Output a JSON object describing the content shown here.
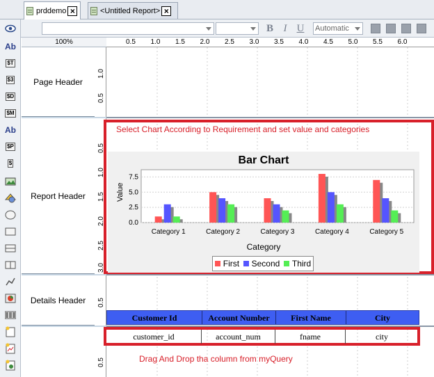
{
  "tabs": [
    {
      "label": "prddemo",
      "active": true
    },
    {
      "label": "<Untitled Report>",
      "active": false
    }
  ],
  "toolbar": {
    "font_size_value": "Automatic",
    "bold_label": "B",
    "italic_label": "I",
    "underline_label": "U"
  },
  "palette": [
    {
      "label": "Ab",
      "icon": "text-field-icon"
    },
    {
      "label": "$T",
      "icon": "string-field-icon"
    },
    {
      "label": "$3",
      "icon": "number-field-icon"
    },
    {
      "label": "$D",
      "icon": "date-field-icon"
    },
    {
      "label": "$M",
      "icon": "message-field-icon"
    },
    {
      "label": "Ab",
      "icon": "label-icon"
    },
    {
      "label": "$P",
      "icon": "resource-field-icon"
    },
    {
      "label": "$",
      "icon": "resource-message-icon"
    }
  ],
  "zoom": "100%",
  "ruler": [
    "0.5",
    "1.0",
    "1.5",
    "2.0",
    "2.5",
    "3.0",
    "3.5",
    "4.0",
    "4.5",
    "5.0",
    "5.5",
    "6.0"
  ],
  "bands": {
    "page_header": "Page Header",
    "report_header": "Report Header",
    "details_header": "Details Header"
  },
  "vruler": {
    "page_header": [
      "0.5",
      "1.0"
    ],
    "report_header": [
      "0.5",
      "1.0",
      "1.5",
      "2.0",
      "2.5",
      "3.0"
    ],
    "details_header": [
      "0.5"
    ],
    "details": [
      "0.5"
    ]
  },
  "annotations": {
    "chart_note": "Select Chart According to Requirement and set value and categories",
    "drag_note": "Drag And Drop tha column from myQuery"
  },
  "colors": {
    "annotation_red": "#d8202a",
    "header_blue": "#3e5ef2",
    "first": "#ff5555",
    "second": "#5555ff",
    "third": "#55ee55"
  },
  "chart_data": {
    "type": "bar",
    "title": "Bar Chart",
    "xlabel": "Category",
    "ylabel": "Value",
    "categories": [
      "Category 1",
      "Category 2",
      "Category 3",
      "Category 4",
      "Category 5"
    ],
    "series": [
      {
        "name": "First",
        "values": [
          1.0,
          5.0,
          4.0,
          8.0,
          7.0
        ]
      },
      {
        "name": "Second",
        "values": [
          3.0,
          4.0,
          3.0,
          5.0,
          4.0
        ]
      },
      {
        "name": "Third",
        "values": [
          1.0,
          3.0,
          2.0,
          3.0,
          2.0
        ]
      }
    ],
    "ylim": [
      0,
      8
    ],
    "yticks": [
      "0.0",
      "2.5",
      "5.0",
      "7.5"
    ],
    "legend": "bottom",
    "grid": true
  },
  "table": {
    "headers": [
      "Customer Id",
      "Account Number",
      "First Name",
      "City"
    ],
    "fields": [
      "customer_id",
      "account_num",
      "fname",
      "city"
    ]
  }
}
